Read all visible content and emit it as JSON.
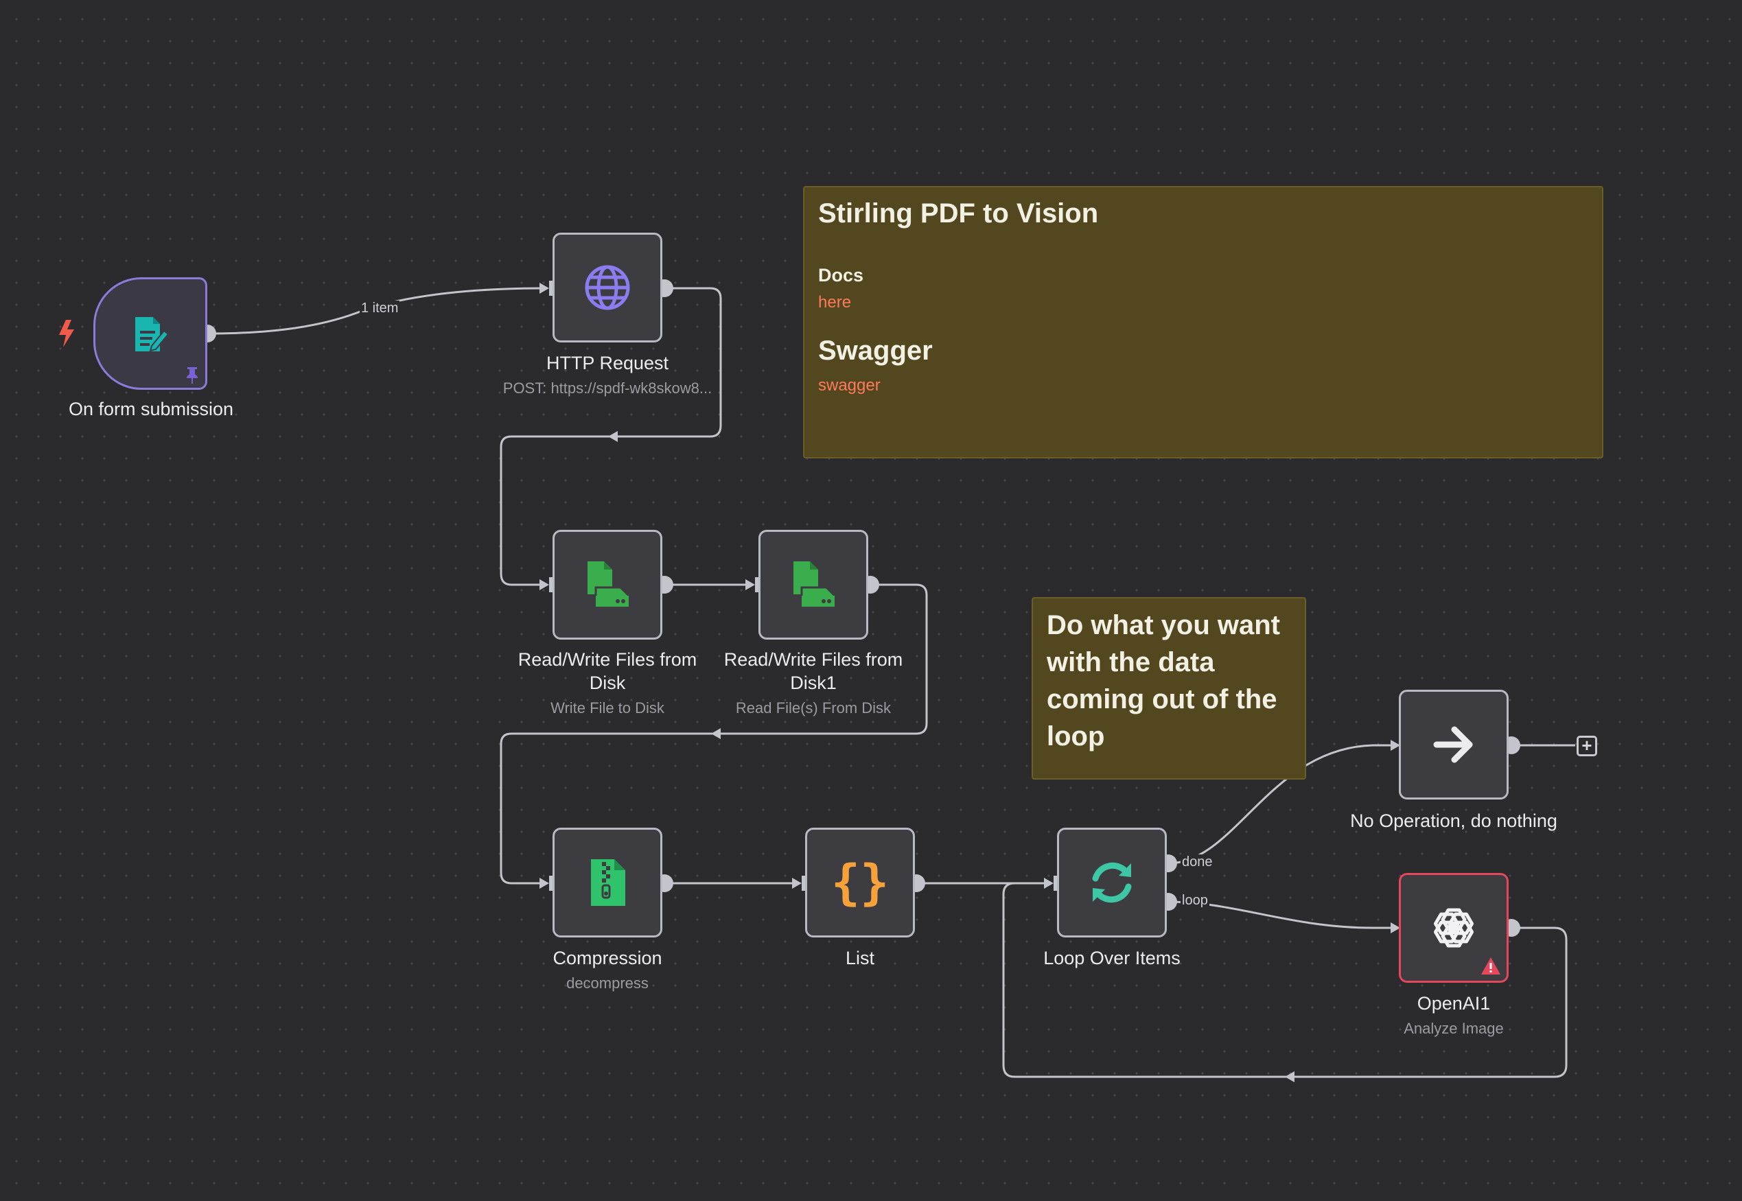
{
  "nodes": {
    "form": {
      "label": "On form submission"
    },
    "http": {
      "label": "HTTP Request",
      "subtitle": "POST: https://spdf-wk8skow8..."
    },
    "write": {
      "label_line1": "Read/Write Files from",
      "label_line2": "Disk",
      "subtitle": "Write File to Disk"
    },
    "read": {
      "label_line1": "Read/Write Files from",
      "label_line2": "Disk1",
      "subtitle": "Read File(s) From Disk"
    },
    "compression": {
      "label": "Compression",
      "subtitle": "decompress"
    },
    "list": {
      "label": "List"
    },
    "loop": {
      "label": "Loop Over Items"
    },
    "noop": {
      "label": "No Operation, do nothing"
    },
    "openai": {
      "label": "OpenAI1",
      "subtitle": "Analyze Image"
    }
  },
  "edge_labels": {
    "items": "1 item",
    "done": "done",
    "loop": "loop"
  },
  "sticky1": {
    "title": "Stirling PDF to Vision",
    "docs_heading": "Docs",
    "docs_link": "here",
    "swagger_heading": "Swagger",
    "swagger_link": "swagger"
  },
  "sticky2": {
    "line1": "Do what you want",
    "line2": "with the data",
    "line3": "coming out of the",
    "line4": "loop"
  },
  "colors": {
    "canvas": "#2b2b2d",
    "node_border": "#b9b9c3",
    "trigger_border": "#8c7bd9",
    "error": "#e5475c",
    "sticky_bg": "#53471f",
    "link": "#ff7a5a"
  }
}
